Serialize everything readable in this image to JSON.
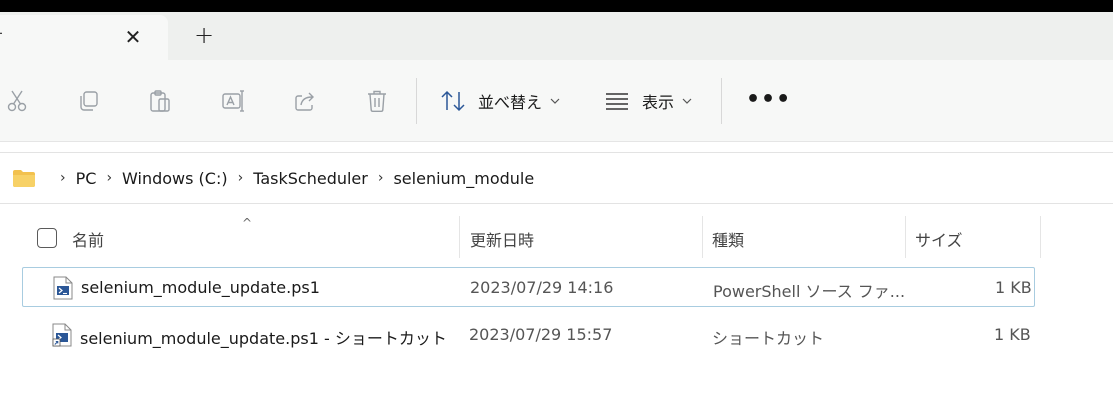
{
  "tab": {
    "lead_glyph": "-",
    "close_glyph": "✕",
    "new_tab_glyph": "+"
  },
  "toolbar": {
    "icons": [
      "cut-icon",
      "copy-icon",
      "paste-icon",
      "rename-icon",
      "share-icon",
      "delete-icon"
    ],
    "sort_label": "並べ替え",
    "view_label": "表示",
    "more_label": "•••"
  },
  "breadcrumb": {
    "items": [
      "PC",
      "Windows (C:)",
      "TaskScheduler",
      "selenium_module"
    ],
    "separator": "›"
  },
  "columns": {
    "name": "名前",
    "modified": "更新日時",
    "type": "種類",
    "size": "サイズ",
    "sort_caret": "^"
  },
  "rows": [
    {
      "name": "selenium_module_update.ps1",
      "modified": "2023/07/29 14:16",
      "type": "PowerShell ソース ファ...",
      "size": "1 KB"
    },
    {
      "name": "selenium_module_update.ps1 - ショートカット",
      "modified": "2023/07/29 15:57",
      "type": "ショートカット",
      "size": "1 KB"
    }
  ],
  "colors": {
    "folder": "#f2c14e",
    "selection_border": "#a8cce0",
    "ps_icon": "#2b5797"
  }
}
